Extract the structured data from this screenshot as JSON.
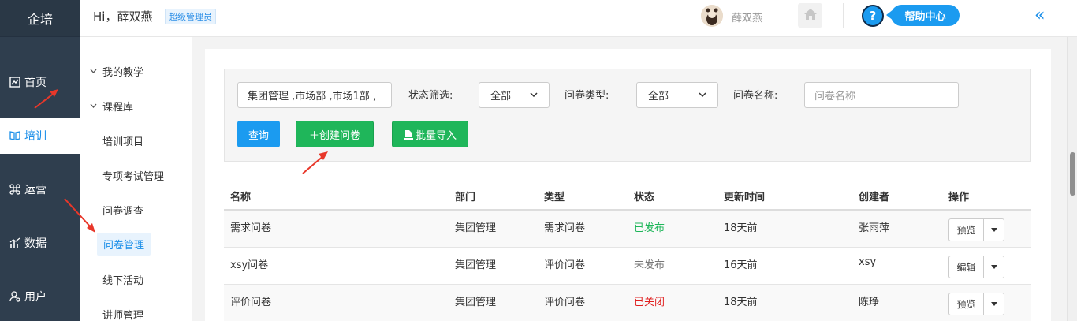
{
  "brand": "企培",
  "nav": [
    {
      "label": "首页",
      "icon": "chart-icon"
    },
    {
      "label": "培训",
      "icon": "book-icon",
      "active": true
    },
    {
      "label": "运营",
      "icon": "command-icon"
    },
    {
      "label": "数据",
      "icon": "bar-chart-icon"
    },
    {
      "label": "用户",
      "icon": "user-gear-icon"
    }
  ],
  "subnav": {
    "groups": [
      "我的教学",
      "课程库"
    ],
    "items": [
      "培训项目",
      "专项考试管理",
      "问卷调查",
      "问卷管理",
      "线下活动",
      "讲师管理"
    ],
    "active_item": "问卷管理"
  },
  "header": {
    "greeting": "Hi，薛双燕",
    "role": "超级管理员",
    "user_name": "薛双燕",
    "help": "?",
    "help_center": "帮助中心",
    "collapse": "«"
  },
  "filters": {
    "department_value": "集团管理 ,市场部 ,市场1部 ,",
    "status_label": "状态筛选:",
    "status_value": "全部",
    "type_label": "问卷类型:",
    "type_value": "全部",
    "name_label": "问卷名称:",
    "name_placeholder": "问卷名称",
    "query_button": "查询",
    "create_button": "＋创建问卷",
    "import_button": "批量导入"
  },
  "table": {
    "headers": [
      "名称",
      "部门",
      "类型",
      "状态",
      "更新时间",
      "创建者",
      "操作"
    ],
    "rows": [
      {
        "name": "需求问卷",
        "dept": "集团管理",
        "type": "需求问卷",
        "status": "已发布",
        "status_kind": "published",
        "updated": "18天前",
        "creator": "张雨萍",
        "action": "预览"
      },
      {
        "name": "xsy问卷",
        "dept": "集团管理",
        "type": "评价问卷",
        "status": "未发布",
        "status_kind": "unpublished",
        "updated": "16天前",
        "creator": "xsy",
        "action": "编辑"
      },
      {
        "name": "评价问卷",
        "dept": "集团管理",
        "type": "评价问卷",
        "status": "已关闭",
        "status_kind": "closed",
        "updated": "18天前",
        "creator": "陈琤",
        "action": "预览"
      }
    ]
  },
  "colors": {
    "nav_bg": "#2f3e4e",
    "accent": "#1b9bf0",
    "green": "#1fb65a",
    "red": "#e02020",
    "annotation_arrow": "#e8372a"
  }
}
